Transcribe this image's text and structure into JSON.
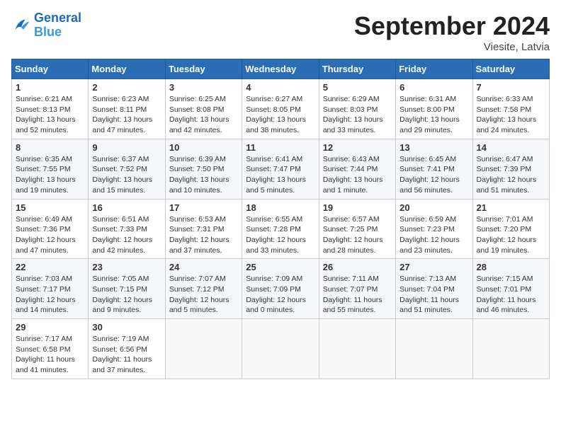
{
  "logo": {
    "line1": "General",
    "line2": "Blue"
  },
  "title": "September 2024",
  "subtitle": "Viesite, Latvia",
  "days_of_week": [
    "Sunday",
    "Monday",
    "Tuesday",
    "Wednesday",
    "Thursday",
    "Friday",
    "Saturday"
  ],
  "weeks": [
    [
      {
        "day": 1,
        "info": "Sunrise: 6:21 AM\nSunset: 8:13 PM\nDaylight: 13 hours\nand 52 minutes."
      },
      {
        "day": 2,
        "info": "Sunrise: 6:23 AM\nSunset: 8:11 PM\nDaylight: 13 hours\nand 47 minutes."
      },
      {
        "day": 3,
        "info": "Sunrise: 6:25 AM\nSunset: 8:08 PM\nDaylight: 13 hours\nand 42 minutes."
      },
      {
        "day": 4,
        "info": "Sunrise: 6:27 AM\nSunset: 8:05 PM\nDaylight: 13 hours\nand 38 minutes."
      },
      {
        "day": 5,
        "info": "Sunrise: 6:29 AM\nSunset: 8:03 PM\nDaylight: 13 hours\nand 33 minutes."
      },
      {
        "day": 6,
        "info": "Sunrise: 6:31 AM\nSunset: 8:00 PM\nDaylight: 13 hours\nand 29 minutes."
      },
      {
        "day": 7,
        "info": "Sunrise: 6:33 AM\nSunset: 7:58 PM\nDaylight: 13 hours\nand 24 minutes."
      }
    ],
    [
      {
        "day": 8,
        "info": "Sunrise: 6:35 AM\nSunset: 7:55 PM\nDaylight: 13 hours\nand 19 minutes."
      },
      {
        "day": 9,
        "info": "Sunrise: 6:37 AM\nSunset: 7:52 PM\nDaylight: 13 hours\nand 15 minutes."
      },
      {
        "day": 10,
        "info": "Sunrise: 6:39 AM\nSunset: 7:50 PM\nDaylight: 13 hours\nand 10 minutes."
      },
      {
        "day": 11,
        "info": "Sunrise: 6:41 AM\nSunset: 7:47 PM\nDaylight: 13 hours\nand 5 minutes."
      },
      {
        "day": 12,
        "info": "Sunrise: 6:43 AM\nSunset: 7:44 PM\nDaylight: 13 hours\nand 1 minute."
      },
      {
        "day": 13,
        "info": "Sunrise: 6:45 AM\nSunset: 7:41 PM\nDaylight: 12 hours\nand 56 minutes."
      },
      {
        "day": 14,
        "info": "Sunrise: 6:47 AM\nSunset: 7:39 PM\nDaylight: 12 hours\nand 51 minutes."
      }
    ],
    [
      {
        "day": 15,
        "info": "Sunrise: 6:49 AM\nSunset: 7:36 PM\nDaylight: 12 hours\nand 47 minutes."
      },
      {
        "day": 16,
        "info": "Sunrise: 6:51 AM\nSunset: 7:33 PM\nDaylight: 12 hours\nand 42 minutes."
      },
      {
        "day": 17,
        "info": "Sunrise: 6:53 AM\nSunset: 7:31 PM\nDaylight: 12 hours\nand 37 minutes."
      },
      {
        "day": 18,
        "info": "Sunrise: 6:55 AM\nSunset: 7:28 PM\nDaylight: 12 hours\nand 33 minutes."
      },
      {
        "day": 19,
        "info": "Sunrise: 6:57 AM\nSunset: 7:25 PM\nDaylight: 12 hours\nand 28 minutes."
      },
      {
        "day": 20,
        "info": "Sunrise: 6:59 AM\nSunset: 7:23 PM\nDaylight: 12 hours\nand 23 minutes."
      },
      {
        "day": 21,
        "info": "Sunrise: 7:01 AM\nSunset: 7:20 PM\nDaylight: 12 hours\nand 19 minutes."
      }
    ],
    [
      {
        "day": 22,
        "info": "Sunrise: 7:03 AM\nSunset: 7:17 PM\nDaylight: 12 hours\nand 14 minutes."
      },
      {
        "day": 23,
        "info": "Sunrise: 7:05 AM\nSunset: 7:15 PM\nDaylight: 12 hours\nand 9 minutes."
      },
      {
        "day": 24,
        "info": "Sunrise: 7:07 AM\nSunset: 7:12 PM\nDaylight: 12 hours\nand 5 minutes."
      },
      {
        "day": 25,
        "info": "Sunrise: 7:09 AM\nSunset: 7:09 PM\nDaylight: 12 hours\nand 0 minutes."
      },
      {
        "day": 26,
        "info": "Sunrise: 7:11 AM\nSunset: 7:07 PM\nDaylight: 11 hours\nand 55 minutes."
      },
      {
        "day": 27,
        "info": "Sunrise: 7:13 AM\nSunset: 7:04 PM\nDaylight: 11 hours\nand 51 minutes."
      },
      {
        "day": 28,
        "info": "Sunrise: 7:15 AM\nSunset: 7:01 PM\nDaylight: 11 hours\nand 46 minutes."
      }
    ],
    [
      {
        "day": 29,
        "info": "Sunrise: 7:17 AM\nSunset: 6:58 PM\nDaylight: 11 hours\nand 41 minutes."
      },
      {
        "day": 30,
        "info": "Sunrise: 7:19 AM\nSunset: 6:56 PM\nDaylight: 11 hours\nand 37 minutes."
      },
      null,
      null,
      null,
      null,
      null
    ]
  ]
}
